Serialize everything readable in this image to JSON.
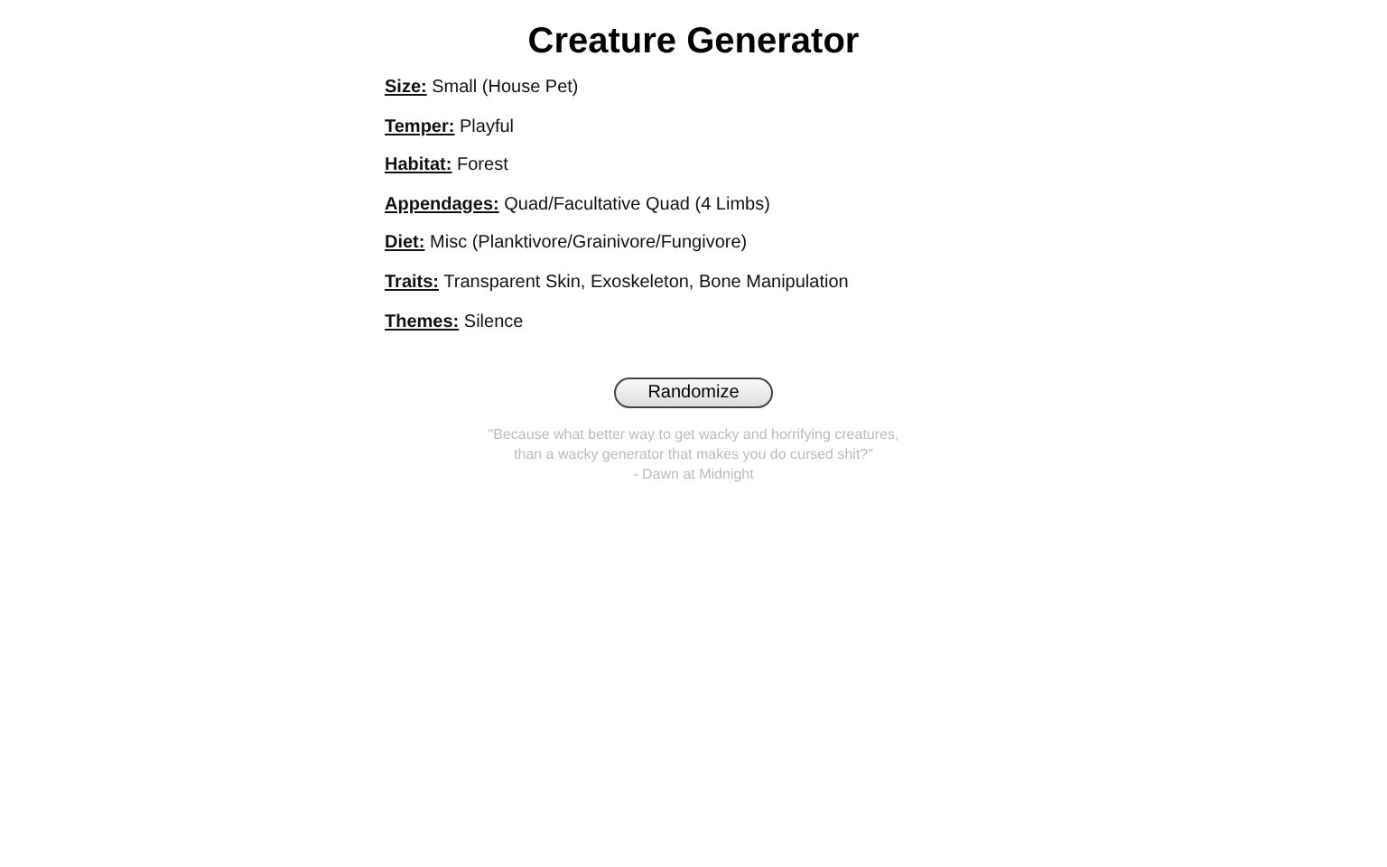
{
  "title": "Creature Generator",
  "attributes": [
    {
      "label": "Size:",
      "value": "Small (House Pet)"
    },
    {
      "label": "Temper:",
      "value": "Playful"
    },
    {
      "label": "Habitat:",
      "value": "Forest"
    },
    {
      "label": "Appendages:",
      "value": "Quad/Facultative Quad (4 Limbs)"
    },
    {
      "label": "Diet:",
      "value": "Misc (Planktivore/Grainivore/Fungivore)"
    },
    {
      "label": "Traits:",
      "value": "Transparent Skin, Exoskeleton, Bone Manipulation"
    },
    {
      "label": "Themes:",
      "value": "Silence"
    }
  ],
  "button": "Randomize",
  "quote": {
    "lines": [
      "\"Because what better way to get wacky and horrifying creatures,",
      "than a wacky generator that makes you do cursed shit?\""
    ],
    "attribution": "- Dawn at Midnight"
  }
}
